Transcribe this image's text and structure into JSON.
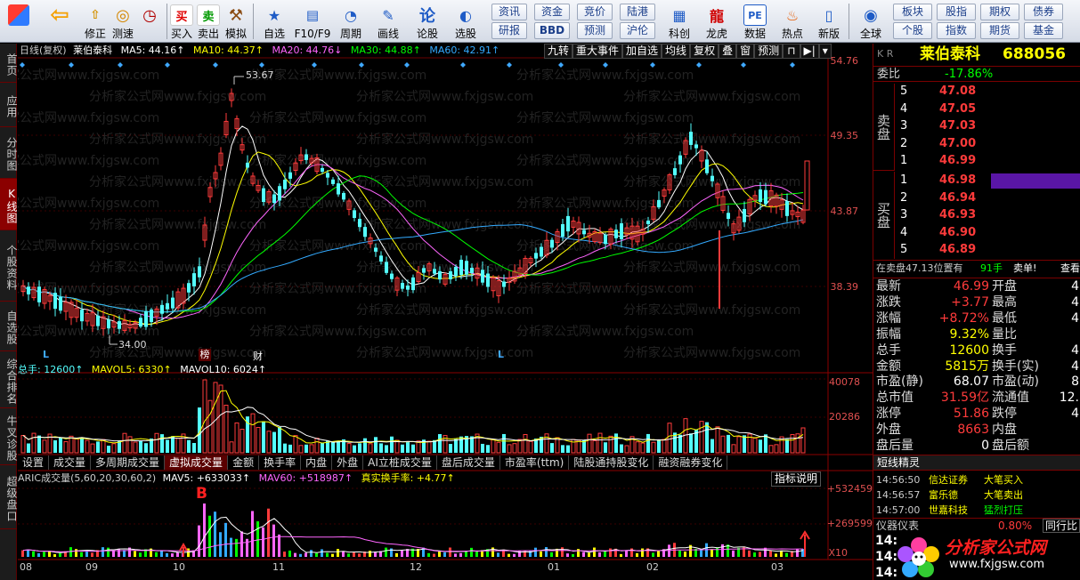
{
  "toolbar": {
    "buttons": [
      {
        "label": "",
        "icon": "grid-icon"
      },
      {
        "label": "",
        "icon": "back-arrow-icon"
      },
      {
        "label": "修正",
        "icon": "up-down-icon"
      },
      {
        "label": "测速",
        "icon": "speed-icon"
      },
      {
        "label": "买入",
        "icon": "buy-icon",
        "glyph": "买"
      },
      {
        "label": "卖出",
        "icon": "sell-icon",
        "glyph": "卖"
      },
      {
        "label": "模拟",
        "icon": "hammer-icon"
      },
      {
        "label": "自选",
        "icon": "star-icon"
      },
      {
        "label": "F10/F9",
        "icon": "f10-icon"
      },
      {
        "label": "周期",
        "icon": "period-icon"
      },
      {
        "label": "画线",
        "icon": "pen-icon"
      },
      {
        "label": "论股",
        "icon": "chat-icon",
        "glyph": "论"
      },
      {
        "label": "选股",
        "icon": "search-chart-icon"
      },
      {
        "label": "科创",
        "icon": "tech-icon"
      },
      {
        "label": "龙虎",
        "icon": "dragon-icon"
      },
      {
        "label": "数据",
        "icon": "pe-icon",
        "glyph": "PE"
      },
      {
        "label": "热点",
        "icon": "fire-icon"
      },
      {
        "label": "新版",
        "icon": "new-icon"
      },
      {
        "label": "全球",
        "icon": "globe-icon"
      }
    ],
    "tabs": [
      "资讯",
      "资金",
      "竞价",
      "陆港",
      "研报",
      "BBD",
      "预测",
      "沪伦",
      "板块",
      "股指",
      "期权",
      "债券",
      "个股",
      "指数",
      "期货",
      "基金"
    ]
  },
  "left_nav": [
    "首页",
    "应用",
    "分时图",
    "K线图",
    "个股资料",
    "自选股",
    "综合排名",
    "牛叉诊股",
    "超级盘口"
  ],
  "chart_header": {
    "period": "日线(复权)",
    "name": "莱伯泰科",
    "ma5": "MA5: 44.16↑",
    "ma10": "MA10: 44.37↑",
    "ma20": "MA20: 44.76↓",
    "ma30": "MA30: 44.88↑",
    "ma60": "MA60: 42.91↑",
    "tools": [
      "九转",
      "重大事件",
      "加自选",
      "均线",
      "复权",
      "叠",
      "窗",
      "预测"
    ]
  },
  "price_axis": {
    "labels": [
      "54.76",
      "49.35",
      "43.87",
      "38.39"
    ],
    "high_label": "53.67",
    "low_label": "34.00"
  },
  "markers": {
    "bang": "榜",
    "cai": "财",
    "l": "L"
  },
  "volume_header": {
    "total": "总手: 12600↑",
    "mavol5": "MAVOL5: 6330↑",
    "mavol10": "MAVOL10: 6024↑",
    "axis": [
      "40078",
      "20286"
    ]
  },
  "indicator_tabs": [
    "设置",
    "成交量",
    "多周期成交量",
    "虚拟成交量",
    "金额",
    "换手率",
    "内盘",
    "外盘",
    "AI立桩成交量",
    "盘后成交量",
    "市盈率(ttm)",
    "陆股通持股变化",
    "融资融券变化"
  ],
  "aric": {
    "label": "ARIC成交量(5,60,20,30,60,2)",
    "mav5": "MAV5: +633033↑",
    "mav60": "MAV60: +518987↑",
    "real": "真实换手率: +4.77↑",
    "axis": [
      "+532459",
      "+269599"
    ],
    "x10": "X10",
    "b_marker": "B",
    "explain": "指标说明"
  },
  "date_axis": [
    "08",
    "09",
    "10",
    "11",
    "12",
    "01",
    "02",
    "03"
  ],
  "watermark": "分析家公式网www.fxjgsw.com",
  "right_panel": {
    "symbol": "莱伯泰科",
    "code": "688056",
    "kr": "K R",
    "weibi_label": "委比",
    "weibi": "-17.86%",
    "sell_label": "卖盘",
    "buy_label": "买盘",
    "sells": [
      {
        "n": "5",
        "p": "47.08"
      },
      {
        "n": "4",
        "p": "47.05"
      },
      {
        "n": "3",
        "p": "47.03"
      },
      {
        "n": "2",
        "p": "47.00"
      },
      {
        "n": "1",
        "p": "46.99"
      }
    ],
    "buys": [
      {
        "n": "1",
        "p": "46.98"
      },
      {
        "n": "2",
        "p": "46.94"
      },
      {
        "n": "3",
        "p": "46.93"
      },
      {
        "n": "4",
        "p": "46.90"
      },
      {
        "n": "5",
        "p": "46.89"
      }
    ],
    "queue": "在卖盘47.13位置有",
    "queue_n": "91手",
    "queue_t": "卖单!",
    "queue_link": "查看",
    "stats": [
      {
        "l": "最新",
        "v": "46.99",
        "l2": "开盘",
        "v2": "4"
      },
      {
        "l": "涨跌",
        "v": "+3.77",
        "l2": "最高",
        "v2": "4"
      },
      {
        "l": "涨幅",
        "v": "+8.72%",
        "l2": "最低",
        "v2": "4"
      },
      {
        "l": "振幅",
        "v": "9.32%",
        "l2": "量比",
        "v2": ""
      },
      {
        "l": "总手",
        "v": "12600",
        "l2": "换手",
        "v2": "4"
      },
      {
        "l": "金额",
        "v": "5815万",
        "l2": "换手(实)",
        "v2": "4"
      },
      {
        "l": "市盈(静)",
        "v": "68.07",
        "l2": "市盈(动)",
        "v2": "8"
      },
      {
        "l": "总市值",
        "v": "31.59亿",
        "l2": "流通值",
        "v2": "12."
      },
      {
        "l": "涨停",
        "v": "51.86",
        "l2": "跌停",
        "v2": "4"
      },
      {
        "l": "外盘",
        "v": "8663",
        "l2": "内盘",
        "v2": ""
      },
      {
        "l": "盘后量",
        "v": "0",
        "l2": "盘后额",
        "v2": ""
      }
    ],
    "news_title": "短线精灵",
    "news": [
      {
        "t": "14:56:50",
        "s": "信达证券",
        "a": "大笔买入"
      },
      {
        "t": "14:56:57",
        "s": "富乐德",
        "a": "大笔卖出"
      },
      {
        "t": "14:57:00",
        "s": "世嘉科技",
        "a": "猛烈打压"
      }
    ],
    "gauge_label": "仪器仪表",
    "gauge_val": "0.80%",
    "gauge_btn": "同行比",
    "bottom_times": [
      "14:",
      "14:",
      "14:"
    ],
    "logo": "分析家公式网",
    "logo_url": "www.fxjgsw.com"
  },
  "colors": {
    "up": "#ff3b3b",
    "down": "#54ffff",
    "ma5": "#ffffff",
    "ma10": "#ffff00",
    "ma20": "#ff66ff",
    "ma30": "#00ff00",
    "ma60": "#33aaff"
  }
}
